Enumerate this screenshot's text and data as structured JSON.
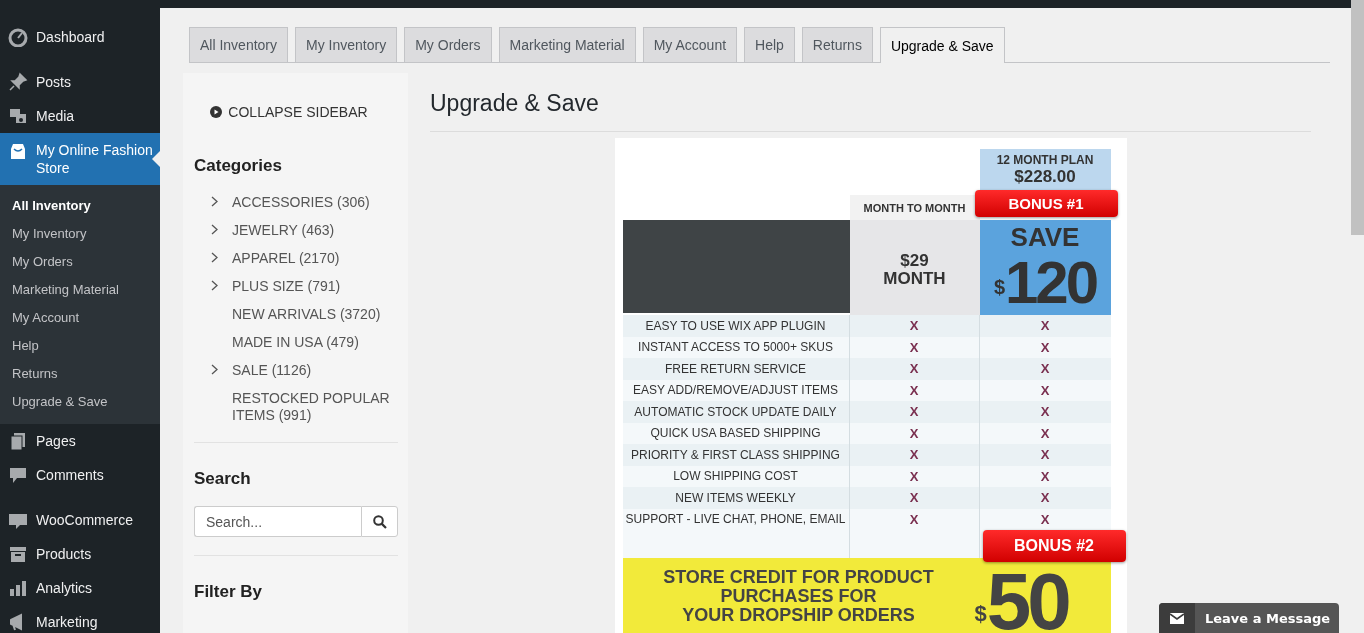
{
  "admin_menu": {
    "groups": [
      {
        "items": [
          {
            "label": "Dashboard",
            "selected": false
          }
        ]
      },
      {
        "items": [
          {
            "label": "Posts",
            "selected": false
          },
          {
            "label": "Media",
            "selected": false
          },
          {
            "label": "My Online Fashion Store",
            "selected": true,
            "submenu": [
              {
                "label": "All Inventory",
                "selected": true
              },
              {
                "label": "My Inventory",
                "selected": false
              },
              {
                "label": "My Orders",
                "selected": false
              },
              {
                "label": "Marketing Material",
                "selected": false
              },
              {
                "label": "My Account",
                "selected": false
              },
              {
                "label": "Help",
                "selected": false
              },
              {
                "label": "Returns",
                "selected": false
              },
              {
                "label": "Upgrade & Save",
                "selected": false
              }
            ]
          },
          {
            "label": "Pages",
            "selected": false
          },
          {
            "label": "Comments",
            "selected": false
          }
        ]
      },
      {
        "items": [
          {
            "label": "WooCommerce",
            "selected": false
          },
          {
            "label": "Products",
            "selected": false
          },
          {
            "label": "Analytics",
            "selected": false
          },
          {
            "label": "Marketing",
            "selected": false
          }
        ]
      }
    ]
  },
  "tabs": [
    {
      "label": "All Inventory",
      "selected": false
    },
    {
      "label": "My Inventory",
      "selected": false
    },
    {
      "label": "My Orders",
      "selected": false
    },
    {
      "label": "Marketing Material",
      "selected": false
    },
    {
      "label": "My Account",
      "selected": false
    },
    {
      "label": "Help",
      "selected": false
    },
    {
      "label": "Returns",
      "selected": false
    },
    {
      "label": "Upgrade & Save",
      "selected": true
    }
  ],
  "sidebar": {
    "collapse_label": "COLLAPSE SIDEBAR",
    "categories_title": "Categories",
    "categories": [
      {
        "label": "ACCESSORIES (306)",
        "expandable": true
      },
      {
        "label": "JEWELRY (463)",
        "expandable": true
      },
      {
        "label": "APPAREL (2170)",
        "expandable": true
      },
      {
        "label": "PLUS SIZE (791)",
        "expandable": true
      },
      {
        "label": "NEW ARRIVALS (3720)",
        "expandable": false
      },
      {
        "label": "MADE IN USA (479)",
        "expandable": false
      },
      {
        "label": "SALE (1126)",
        "expandable": true
      },
      {
        "label": "RESTOCKED POPULAR ITEMS (991)",
        "expandable": false
      }
    ],
    "search_title": "Search",
    "search": {
      "placeholder": "Search..."
    },
    "filter_title": "Filter By"
  },
  "content": {
    "heading": "Upgrade & Save",
    "pricing": {
      "plan_name": "12 MONTH PLAN",
      "plan_price": "$228.00",
      "monthly_label": "MONTH TO MONTH",
      "bonus_1": "BONUS #1",
      "monthly_price": "$29",
      "monthly_unit": "MONTH",
      "save_label": "SAVE",
      "save_currency": "$",
      "save_amount": "120",
      "features": [
        {
          "name": "EASY TO USE WIX APP PLUGIN",
          "monthly": "X",
          "yearly": "X"
        },
        {
          "name": "INSTANT ACCESS TO 5000+ SKUS",
          "monthly": "X",
          "yearly": "X"
        },
        {
          "name": "FREE RETURN SERVICE",
          "monthly": "X",
          "yearly": "X"
        },
        {
          "name": "EASY ADD/REMOVE/ADJUST ITEMS",
          "monthly": "X",
          "yearly": "X"
        },
        {
          "name": "AUTOMATIC STOCK UPDATE DAILY",
          "monthly": "X",
          "yearly": "X"
        },
        {
          "name": "QUICK USA BASED SHIPPING",
          "monthly": "X",
          "yearly": "X"
        },
        {
          "name": "PRIORITY & FIRST CLASS SHIPPING",
          "monthly": "X",
          "yearly": "X"
        },
        {
          "name": "LOW SHIPPING COST",
          "monthly": "X",
          "yearly": "X"
        },
        {
          "name": "NEW ITEMS WEEKLY",
          "monthly": "X",
          "yearly": "X"
        },
        {
          "name": "SUPPORT - LIVE CHAT, PHONE, EMAIL",
          "monthly": "X",
          "yearly": "X"
        }
      ],
      "bonus_2": "BONUS #2",
      "credit_lines": [
        "STORE CREDIT FOR PRODUCT",
        "PURCHASES FOR",
        "YOUR DROPSHIP ORDERS"
      ],
      "credit_currency": "$",
      "credit_amount": "50"
    }
  },
  "chat": {
    "label": "Leave a Message"
  }
}
